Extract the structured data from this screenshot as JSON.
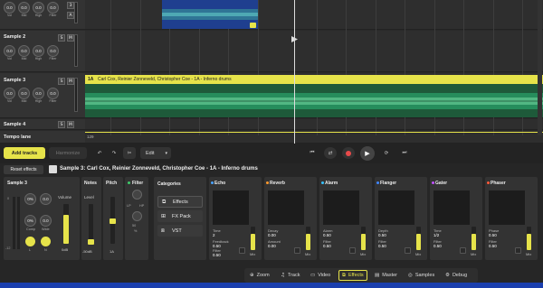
{
  "tracks": {
    "knob_labels": [
      "Vol",
      "Mid",
      "High",
      "Filter"
    ],
    "knob_values": [
      "0.0",
      "0.0",
      "0.0",
      "0.0"
    ],
    "sample2": {
      "name": "Sample 2"
    },
    "sample3": {
      "name": "Sample 3",
      "clip_key": "1A",
      "clip_title": "Carl Cox, Reinier Zonneveld, Christopher Coe - 1A - Inferno drums"
    },
    "sample4": {
      "name": "Sample 4"
    },
    "tempo_lane": "Tempo lane",
    "tempo_value": "129",
    "solo": "S",
    "mute": "M",
    "arm": "A",
    "top_badge": "3"
  },
  "toolbar": {
    "add_tracks": "Add tracks",
    "harmonize": "Harmonize",
    "edit": "Edit"
  },
  "panel": {
    "reset_effects": "Reset effects",
    "title": "Sample 3: Carl Cox, Reinier Zonneveld, Christopher Coe - 1A - Inferno drums",
    "sample_box": {
      "title": "Sample 3",
      "volume_label": "Volume",
      "volume_value": "0dB",
      "k1": "0%",
      "k2": "0.0",
      "k3": "0%",
      "k4": "0.0",
      "comp": "Comp",
      "wide": "Wide",
      "l": "L",
      "n": "N",
      "scale_top": "0",
      "scale_bot": "-12"
    },
    "notes": {
      "title": "Notes",
      "level_label": "Level",
      "level_value": "-50dB"
    },
    "pitch": {
      "title": "Pitch",
      "value": "1A"
    },
    "filter": {
      "title": "Filter",
      "lp": "LP",
      "hp": "HP",
      "value": "50",
      "unit": "%"
    },
    "categories": {
      "title": "Categories",
      "items": [
        "Effects",
        "FX Pack",
        "VST"
      ]
    },
    "effects": [
      {
        "name": "Echo",
        "color": "#4aa3ff",
        "p1": "Time",
        "v1": "2",
        "p2": "Feedback",
        "v2": "0.50",
        "p3": "",
        "v3": "",
        "p4": "Filter",
        "v4": "0.50",
        "mix": 0.7
      },
      {
        "name": "Reverb",
        "color": "#ff9a2e",
        "p1": "Decay",
        "v1": "0.00",
        "p2": "Amount",
        "v2": "0.00",
        "p3": "",
        "v3": "",
        "p4": "",
        "v4": "",
        "mix": 0.7
      },
      {
        "name": "Alarm",
        "color": "#36c3ff",
        "p1": "Alarm",
        "v1": "0.50",
        "p2": "Filter",
        "v2": "0.50",
        "p3": "",
        "v3": "",
        "p4": "",
        "v4": "",
        "mix": 0.7
      },
      {
        "name": "Flanger",
        "color": "#3f86ff",
        "p1": "Depth",
        "v1": "0.50",
        "p2": "Filter",
        "v2": "0.50",
        "p3": "",
        "v3": "",
        "p4": "",
        "v4": "",
        "mix": 0.7
      },
      {
        "name": "Gater",
        "color": "#c050ff",
        "p1": "Time",
        "v1": "1/2",
        "p2": "Filter",
        "v2": "0.50",
        "p3": "",
        "v3": "",
        "p4": "",
        "v4": "",
        "mix": 0.7
      },
      {
        "name": "Phaser",
        "color": "#ff5a3a",
        "p1": "Phase",
        "v1": "0.50",
        "p2": "Filter",
        "v2": "0.50",
        "p3": "",
        "v3": "",
        "p4": "",
        "v4": "",
        "mix": 0.7
      }
    ],
    "mix_label": "Mix"
  },
  "bottom_bar": [
    "Zoom",
    "Track",
    "Video",
    "Effects",
    "Master",
    "Samples",
    "Debug"
  ],
  "colors": {
    "accent": "#e6e34a",
    "waveform": "#2aa36b",
    "record": "#e84a4a"
  }
}
